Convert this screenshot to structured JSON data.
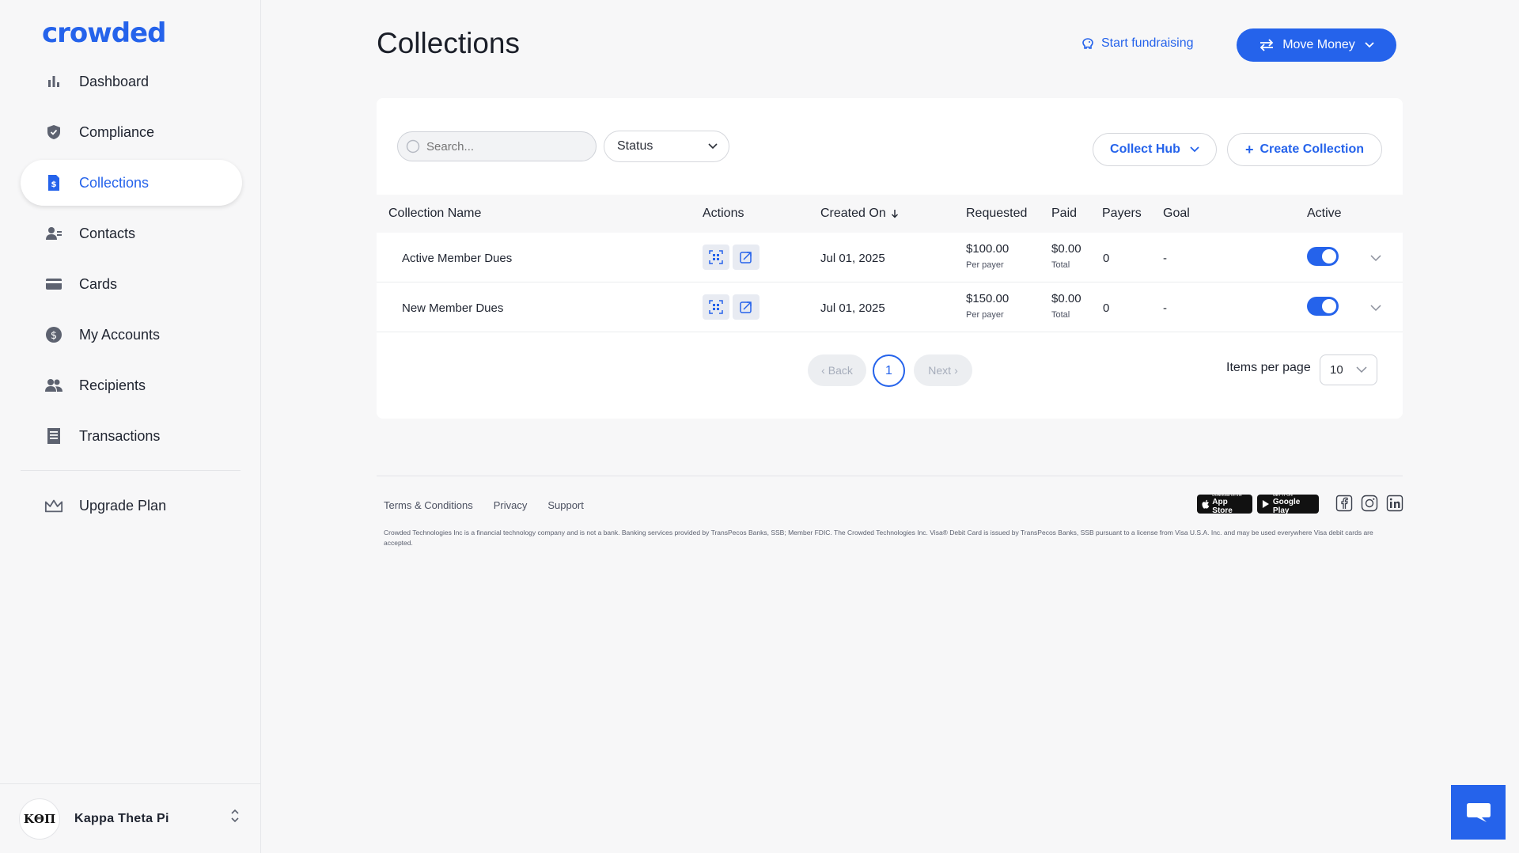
{
  "brand": {
    "logo": "crowded",
    "accent": "#2563eb"
  },
  "sidebar": {
    "items": [
      {
        "label": "Dashboard",
        "icon": "bar-chart-icon",
        "active": false
      },
      {
        "label": "Compliance",
        "icon": "shield-check-icon",
        "active": false
      },
      {
        "label": "Collections",
        "icon": "dollar-document-icon",
        "active": true
      },
      {
        "label": "Contacts",
        "icon": "contacts-icon",
        "active": false
      },
      {
        "label": "Cards",
        "icon": "credit-card-icon",
        "active": false
      },
      {
        "label": "My Accounts",
        "icon": "dollar-circle-icon",
        "active": false
      },
      {
        "label": "Recipients",
        "icon": "people-icon",
        "active": false
      },
      {
        "label": "Transactions",
        "icon": "receipt-icon",
        "active": false
      }
    ],
    "upgrade": {
      "label": "Upgrade Plan",
      "icon": "crown-icon"
    },
    "org": {
      "avatar": "ΚΘΠ",
      "name": "Kappa Theta Pi"
    }
  },
  "header": {
    "title": "Collections",
    "start_fundraising": "Start fundraising",
    "move_money": "Move Money"
  },
  "toolbar": {
    "search_placeholder": "Search...",
    "status_label": "Status",
    "collect_hub": "Collect Hub",
    "create_collection": "Create Collection"
  },
  "table": {
    "columns": [
      "Collection Name",
      "Actions",
      "Created On",
      "Requested",
      "Paid",
      "Payers",
      "Goal",
      "Active"
    ],
    "rows": [
      {
        "name": "Active Member Dues",
        "created_on": "Jul 01, 2025",
        "requested": "$100.00",
        "requested_sub": "Per payer",
        "paid": "$0.00",
        "paid_sub": "Total",
        "payers": "0",
        "goal": "-",
        "active": true
      },
      {
        "name": "New Member Dues",
        "created_on": "Jul 01, 2025",
        "requested": "$150.00",
        "requested_sub": "Per payer",
        "paid": "$0.00",
        "paid_sub": "Total",
        "payers": "0",
        "goal": "-",
        "active": true
      }
    ]
  },
  "pagination": {
    "back": "Back",
    "next": "Next",
    "current_page": "1",
    "items_per_page_label": "Items per page",
    "items_per_page": "10"
  },
  "footer": {
    "links": [
      "Terms & Conditions",
      "Privacy",
      "Support"
    ],
    "disclaimer": "Crowded Technologies Inc is a financial technology company and is not a bank. Banking services provided by TransPecos Banks, SSB; Member FDIC. The Crowded Technologies Inc. Visa® Debit Card is issued by TransPecos Banks, SSB pursuant to a license from Visa U.S.A. Inc. and may be used everywhere Visa debit cards are accepted.",
    "app_store": {
      "small": "Download on the",
      "big": "App Store"
    },
    "google_play": {
      "small": "GET IT ON",
      "big": "Google Play"
    },
    "social": [
      "facebook-icon",
      "instagram-icon",
      "linkedin-icon"
    ]
  }
}
